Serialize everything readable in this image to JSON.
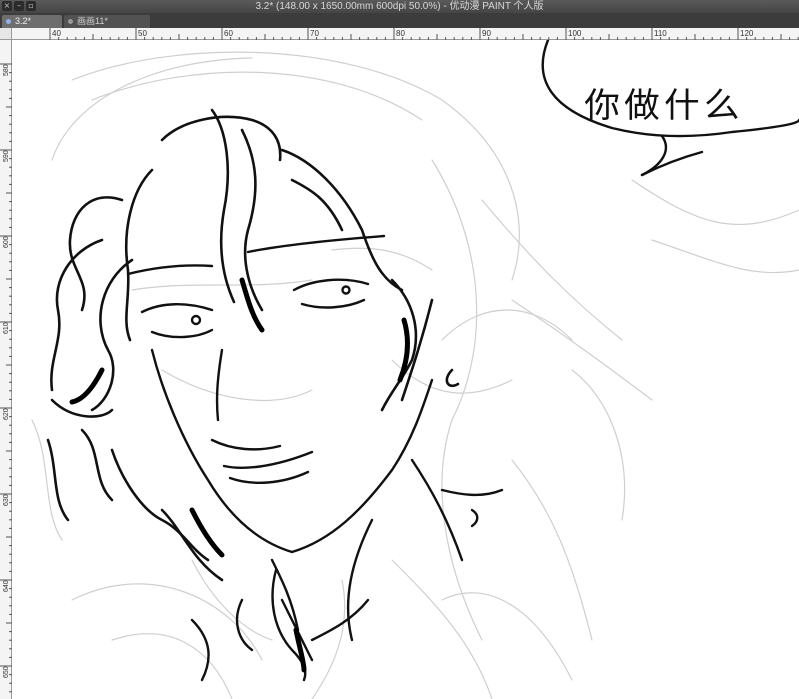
{
  "window": {
    "title": "3.2* (148.00 x 1650.00mm 600dpi 50.0%) - 优动漫 PAINT 个人版",
    "controls": [
      "close-icon",
      "minimize-icon",
      "zoom-icon"
    ]
  },
  "tabs": [
    {
      "label": "3.2*",
      "active": true
    },
    {
      "label": "画画11*",
      "active": false
    }
  ],
  "rulers": {
    "top_labels": [
      "40",
      "50",
      "60",
      "70",
      "80",
      "90",
      "100",
      "110",
      "120"
    ],
    "left_labels": [
      "580",
      "590",
      "600",
      "610",
      "620",
      "630",
      "640",
      "650"
    ],
    "unit": "mm"
  },
  "canvas": {
    "speech_bubble_text": "你做什么",
    "stroke_color": "#111111",
    "sketch_color": "#c8c8c8"
  }
}
